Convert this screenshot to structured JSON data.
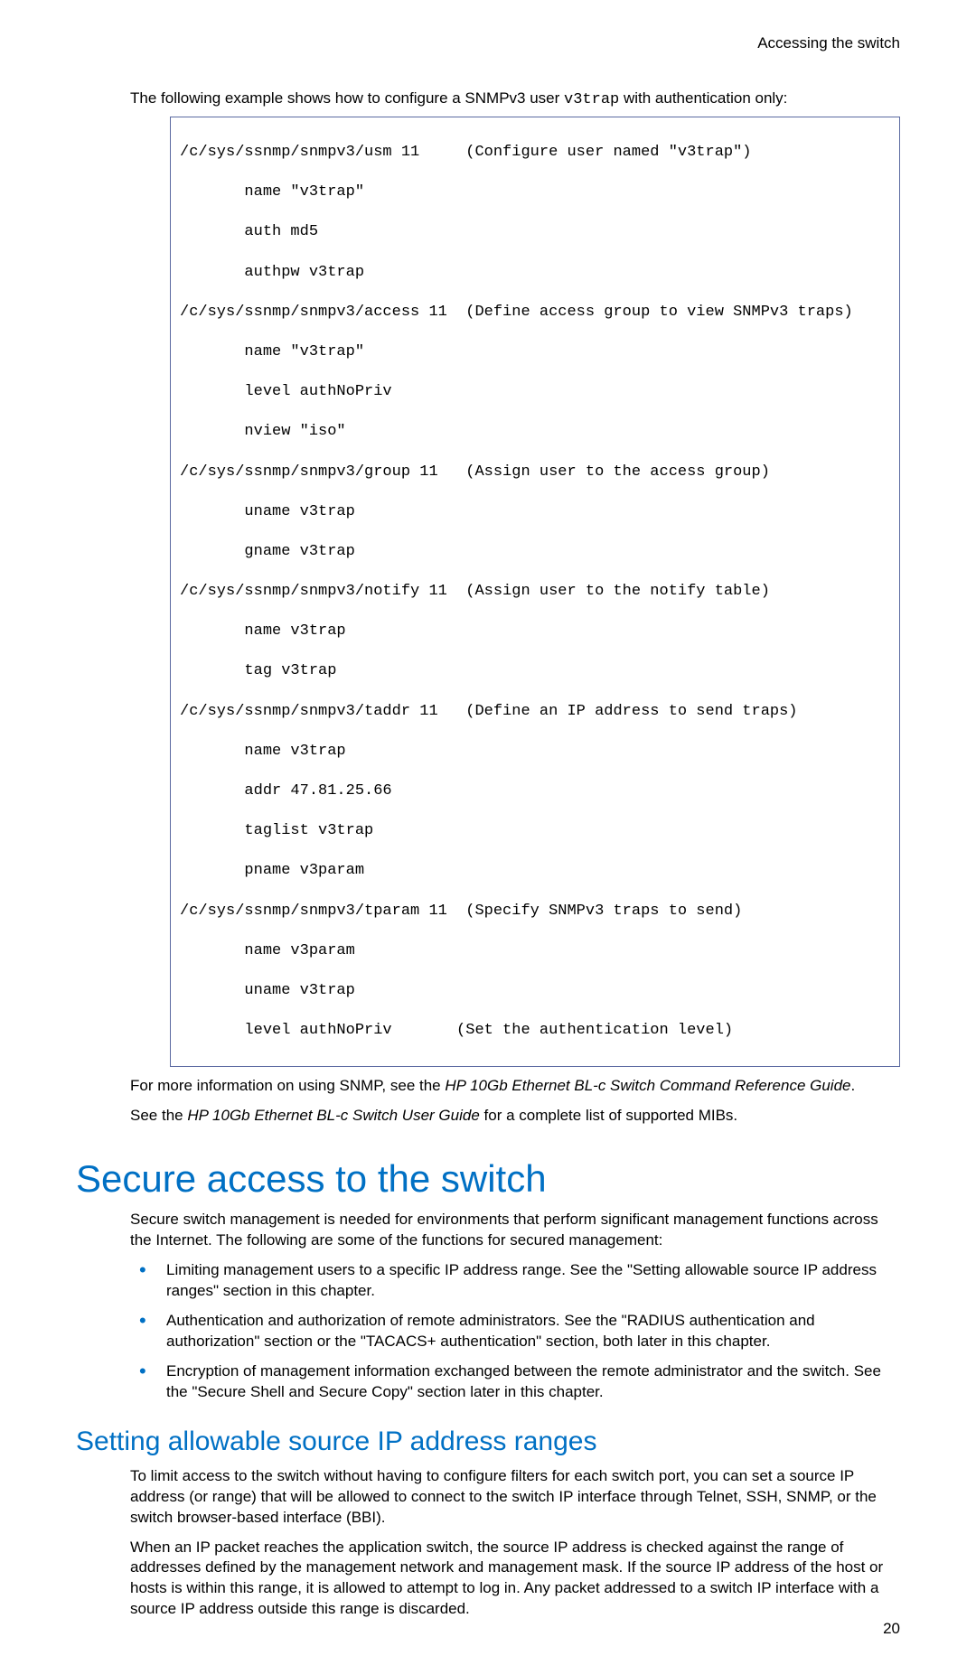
{
  "header": {
    "running": "Accessing the switch"
  },
  "intro": {
    "prefix": "The following example shows how to configure a SNMPv3 user ",
    "user": "v3trap",
    "suffix": " with authentication only:"
  },
  "code": [
    "/c/sys/ssnmp/snmpv3/usm 11     (Configure user named \"v3trap\")",
    "       name \"v3trap\"",
    "       auth md5",
    "       authpw v3trap",
    "/c/sys/ssnmp/snmpv3/access 11  (Define access group to view SNMPv3 traps)",
    "       name \"v3trap\"",
    "       level authNoPriv",
    "       nview \"iso\"",
    "/c/sys/ssnmp/snmpv3/group 11   (Assign user to the access group)",
    "       uname v3trap",
    "       gname v3trap",
    "/c/sys/ssnmp/snmpv3/notify 11  (Assign user to the notify table)",
    "       name v3trap",
    "       tag v3trap",
    "/c/sys/ssnmp/snmpv3/taddr 11   (Define an IP address to send traps)",
    "       name v3trap",
    "       addr 47.81.25.66",
    "       taglist v3trap",
    "       pname v3param",
    "/c/sys/ssnmp/snmpv3/tparam 11  (Specify SNMPv3 traps to send)",
    "       name v3param",
    "       uname v3trap",
    "       level authNoPriv       (Set the authentication level)"
  ],
  "after_code": {
    "p1_a": "For more information on using SNMP, see the ",
    "p1_i": "HP 10Gb Ethernet BL-c Switch Command Reference Guide",
    "p1_b": ".",
    "p2_a": "See the ",
    "p2_i": "HP 10Gb Ethernet BL-c Switch User Guide",
    "p2_b": " for a complete list of supported MIBs."
  },
  "section": {
    "title": "Secure access to the switch",
    "intro": "Secure switch management is needed for environments that perform significant management functions across the Internet. The following are some of the functions for secured management:",
    "bullets": [
      "Limiting management users to a specific IP address range. See the \"Setting allowable source IP address ranges\" section in this chapter.",
      "Authentication and authorization of remote administrators. See the \"RADIUS authentication and authorization\" section or the \"TACACS+ authentication\" section, both later in this chapter.",
      "Encryption of management information exchanged between the remote administrator and the switch. See the \"Secure Shell and Secure Copy\" section later in this chapter."
    ]
  },
  "subsection": {
    "title": "Setting allowable source IP address ranges",
    "p1": "To limit access to the switch without having to configure filters for each switch port, you can set a source IP address (or range) that will be allowed to connect to the switch IP interface through Telnet, SSH, SNMP, or the switch browser-based interface (BBI).",
    "p2": "When an IP packet reaches the application switch, the source IP address is checked against the range of addresses defined by the management network and management mask. If the source IP address of the host or hosts is within this range, it is allowed to attempt to log in. Any packet addressed to a switch IP interface with a source IP address outside this range is discarded."
  },
  "pageNumber": "20"
}
